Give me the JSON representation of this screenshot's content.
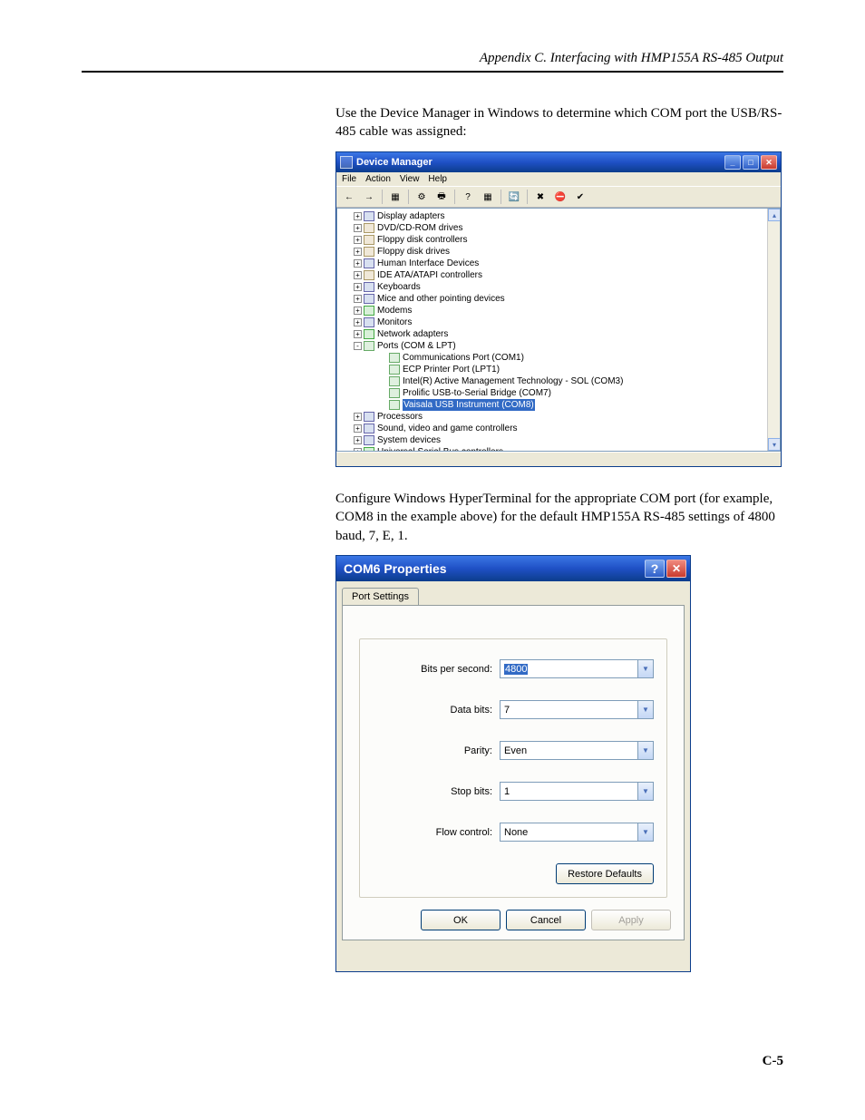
{
  "header": "Appendix C.  Interfacing with HMP155A RS-485 Output",
  "paragraph1": "Use the Device Manager in Windows to determine which COM port the USB/RS-485 cable was assigned:",
  "paragraph2": "Configure Windows HyperTerminal for the appropriate COM port (for example, COM8 in the example above) for the default HMP155A RS-485 settings of 4800 baud, 7, E, 1.",
  "page_number": "C-5",
  "device_manager": {
    "title": "Device Manager",
    "menus": [
      "File",
      "Action",
      "View",
      "Help"
    ],
    "tree": [
      {
        "level": 1,
        "expand": "+",
        "icon": "mon",
        "label": "Display adapters"
      },
      {
        "level": 1,
        "expand": "+",
        "icon": "disk",
        "label": "DVD/CD-ROM drives"
      },
      {
        "level": 1,
        "expand": "+",
        "icon": "disk",
        "label": "Floppy disk controllers"
      },
      {
        "level": 1,
        "expand": "+",
        "icon": "disk",
        "label": "Floppy disk drives"
      },
      {
        "level": 1,
        "expand": "+",
        "icon": "mon",
        "label": "Human Interface Devices"
      },
      {
        "level": 1,
        "expand": "+",
        "icon": "disk",
        "label": "IDE ATA/ATAPI controllers"
      },
      {
        "level": 1,
        "expand": "+",
        "icon": "mon",
        "label": "Keyboards"
      },
      {
        "level": 1,
        "expand": "+",
        "icon": "mon",
        "label": "Mice and other pointing devices"
      },
      {
        "level": 1,
        "expand": "+",
        "icon": "net",
        "label": "Modems"
      },
      {
        "level": 1,
        "expand": "+",
        "icon": "mon",
        "label": "Monitors"
      },
      {
        "level": 1,
        "expand": "+",
        "icon": "net",
        "label": "Network adapters"
      },
      {
        "level": 1,
        "expand": "-",
        "icon": "port",
        "label": "Ports (COM & LPT)"
      },
      {
        "level": 2,
        "expand": "",
        "icon": "port",
        "label": "Communications Port (COM1)"
      },
      {
        "level": 2,
        "expand": "",
        "icon": "port",
        "label": "ECP Printer Port (LPT1)"
      },
      {
        "level": 2,
        "expand": "",
        "icon": "port",
        "label": "Intel(R) Active Management Technology - SOL (COM3)"
      },
      {
        "level": 2,
        "expand": "",
        "icon": "port",
        "label": "Prolific USB-to-Serial Bridge (COM7)"
      },
      {
        "level": 2,
        "expand": "",
        "icon": "port",
        "label": "Vaisala USB Instrument (COM8)",
        "selected": true
      },
      {
        "level": 1,
        "expand": "+",
        "icon": "mon",
        "label": "Processors"
      },
      {
        "level": 1,
        "expand": "+",
        "icon": "mon",
        "label": "Sound, video and game controllers"
      },
      {
        "level": 1,
        "expand": "+",
        "icon": "mon",
        "label": "System devices"
      },
      {
        "level": 1,
        "expand": "+",
        "icon": "net",
        "label": "Universal Serial Bus controllers"
      }
    ]
  },
  "com_dialog": {
    "title": "COM6 Properties",
    "tab": "Port Settings",
    "fields": {
      "bits_per_second": {
        "label": "Bits per second:",
        "value": "4800",
        "focused": true
      },
      "data_bits": {
        "label": "Data bits:",
        "value": "7"
      },
      "parity": {
        "label": "Parity:",
        "value": "Even"
      },
      "stop_bits": {
        "label": "Stop bits:",
        "value": "1"
      },
      "flow_control": {
        "label": "Flow control:",
        "value": "None"
      }
    },
    "restore_defaults": "Restore Defaults",
    "ok": "OK",
    "cancel": "Cancel",
    "apply": "Apply"
  }
}
